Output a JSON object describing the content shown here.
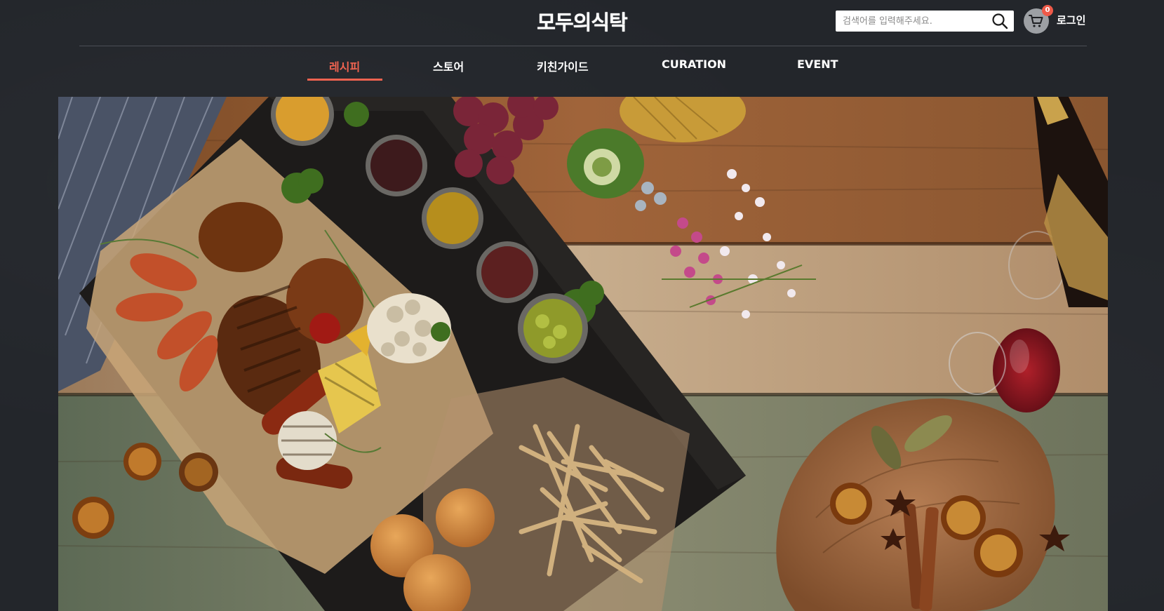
{
  "header": {
    "logo_text": "모두의식탁",
    "search": {
      "placeholder": "검색어를 입력해주세요."
    },
    "cart": {
      "count": "0"
    },
    "login_label": "로그인"
  },
  "nav": {
    "items": [
      {
        "label": "레시피",
        "active": true
      },
      {
        "label": "스토어",
        "active": false
      },
      {
        "label": "키친가이드",
        "active": false
      },
      {
        "label": "CURATION",
        "active": false
      },
      {
        "label": "EVENT",
        "active": false
      }
    ]
  },
  "colors": {
    "accent": "#ef6350",
    "background": "#23262b",
    "badge": "#ee5a49"
  },
  "hero": {
    "type": "photo",
    "icon_names": [
      "search-icon",
      "cart-icon"
    ]
  }
}
